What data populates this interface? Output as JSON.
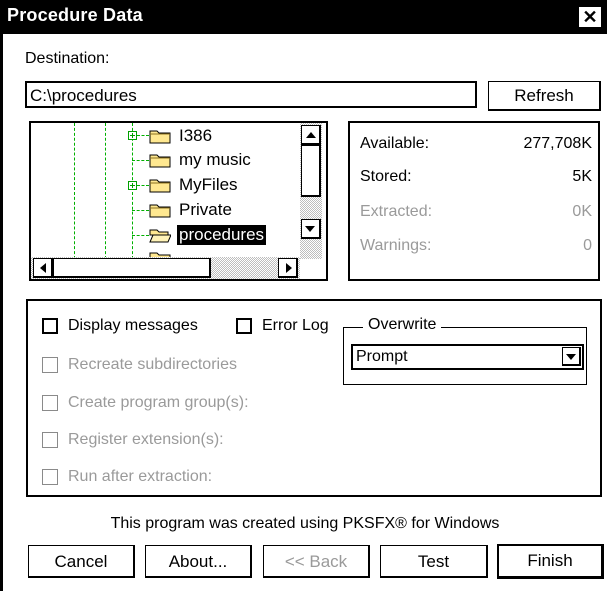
{
  "window": {
    "title": "Procedure Data",
    "close_glyph": "✕"
  },
  "destination": {
    "label": "Destination:",
    "value": "C:\\procedures",
    "refresh_label": "Refresh"
  },
  "tree": {
    "items": [
      {
        "label": "I386",
        "expandable": true,
        "selected": false
      },
      {
        "label": "my music",
        "expandable": false,
        "selected": false
      },
      {
        "label": "MyFiles",
        "expandable": true,
        "selected": false
      },
      {
        "label": "Private",
        "expandable": false,
        "selected": false
      },
      {
        "label": "procedures",
        "expandable": false,
        "selected": true
      }
    ]
  },
  "stats": {
    "available_label": "Available:",
    "available_value": "277,708K",
    "stored_label": "Stored:",
    "stored_value": "5K",
    "extracted_label": "Extracted:",
    "extracted_value": "0K",
    "warnings_label": "Warnings:",
    "warnings_value": "0"
  },
  "options": {
    "display_messages": {
      "label": "Display messages",
      "checked": false,
      "enabled": true
    },
    "error_log": {
      "label": "Error Log",
      "checked": false,
      "enabled": true
    },
    "recreate_subdirectories": {
      "label": "Recreate subdirectories",
      "checked": false,
      "enabled": false
    },
    "create_program_groups": {
      "label": "Create program group(s):",
      "checked": false,
      "enabled": false
    },
    "register_extensions": {
      "label": "Register extension(s):",
      "checked": false,
      "enabled": false
    },
    "run_after_extraction": {
      "label": "Run after extraction:",
      "checked": false,
      "enabled": false
    }
  },
  "overwrite": {
    "legend": "Overwrite",
    "selected": "Prompt"
  },
  "footer": {
    "credit": "This program was created using PKSFX® for Windows"
  },
  "buttons": {
    "cancel": "Cancel",
    "about": "About...",
    "back": "<< Back",
    "test": "Test",
    "finish": "Finish"
  },
  "icons": {
    "folder": "folder-icon",
    "open_folder": "open-folder-icon",
    "close": "close-icon",
    "dropdown": "chevron-down-icon"
  },
  "colors": {
    "titlebar": "#000000",
    "tree_lines": "#00b000",
    "folder_fill": "#ffe890",
    "disabled_text": "#9a9a9a"
  }
}
